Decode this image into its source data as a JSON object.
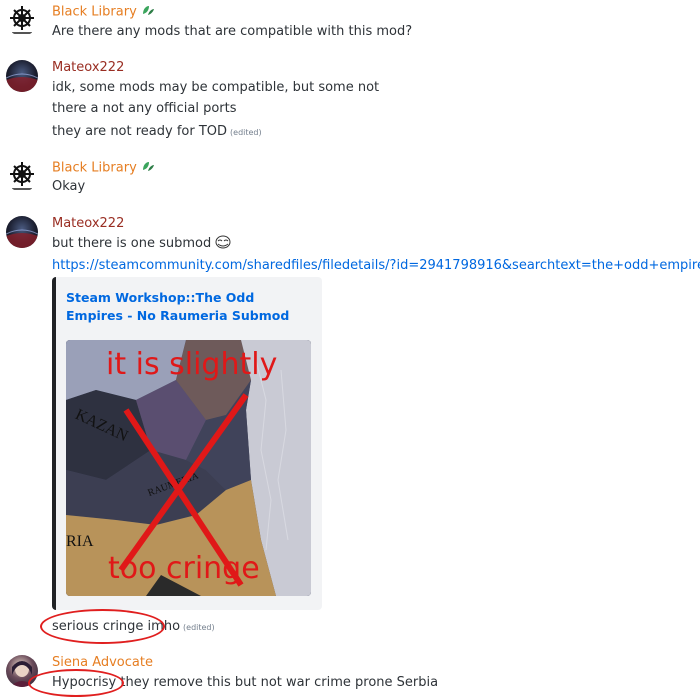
{
  "messages": [
    {
      "author": "Black Library",
      "author_color": "#e67e22",
      "avatar": "black-library-logo",
      "lines": [
        "Are there any mods that are compatible with this mod?"
      ]
    },
    {
      "author": "Mateox222",
      "author_color": "#992d22",
      "avatar": "mateox-avatar",
      "lines": [
        "idk, some mods may be compatible, but some not",
        "there a not any official ports",
        "they are not ready for TOD"
      ],
      "edited": "(edited)"
    },
    {
      "author": "Black Library",
      "author_color": "#e67e22",
      "avatar": "black-library-logo",
      "lines": [
        "Okay"
      ]
    },
    {
      "author": "Mateox222",
      "author_color": "#992d22",
      "avatar": "mateox-avatar",
      "lines": [
        "but there is one submod"
      ],
      "link": "https://steamcommunity.com/sharedfiles/filedetails/?id=2941798916&searchtext=the+odd+empires",
      "embed": {
        "title": "Steam Workshop::The Odd Empires - No Raumeria Submod",
        "image_text_top": "it is slightly",
        "image_text_bottom": "too cringe",
        "map_label_kazan": "KAZAN",
        "map_label_raumeria": "RAUMERIA",
        "map_label_ria": "RIA"
      },
      "after_embed": "serious cringe imho",
      "after_edited": "(edited)"
    },
    {
      "author": "Siena Advocate",
      "author_color": "#e67e22",
      "avatar": "siena-avatar",
      "lines": [
        "Hypocrisy they remove this but not war crime prone Serbia"
      ]
    }
  ]
}
